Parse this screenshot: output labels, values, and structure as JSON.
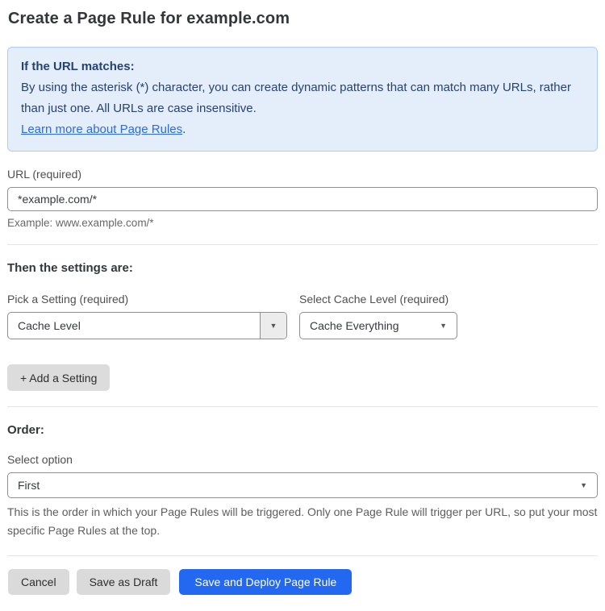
{
  "page": {
    "title": "Create a Page Rule for example.com"
  },
  "info_box": {
    "heading": "If the URL matches:",
    "body": "By using the asterisk (*) character, you can create dynamic patterns that can match many URLs, rather than just one. All URLs are case insensitive.",
    "link_label": "Learn more about Page Rules",
    "link_suffix": "."
  },
  "url_field": {
    "label": "URL (required)",
    "value": "*example.com/*",
    "helper": "Example: www.example.com/*"
  },
  "settings_section": {
    "heading": "Then the settings are:",
    "setting_select": {
      "label": "Pick a Setting (required)",
      "value": "Cache Level"
    },
    "cache_level_select": {
      "label": "Select Cache Level (required)",
      "value": "Cache Everything"
    },
    "add_setting_label": "+ Add a Setting"
  },
  "order_section": {
    "heading": "Order:",
    "select_label": "Select option",
    "value": "First",
    "helper": "This is the order in which your Page Rules will be triggered. Only one Page Rule will trigger per URL, so put your most specific Page Rules at the top."
  },
  "actions": {
    "cancel_label": "Cancel",
    "save_draft_label": "Save as Draft",
    "save_deploy_label": "Save and Deploy Page Rule"
  },
  "icons": {
    "dropdown_arrow": "▼"
  },
  "colors": {
    "info_bg": "#e4eefb",
    "info_border": "#aecdf0",
    "info_text": "#27426f",
    "link_blue": "#2c6ce0",
    "primary_button_bg": "#2268f0",
    "gray_button_bg": "#dadada"
  }
}
